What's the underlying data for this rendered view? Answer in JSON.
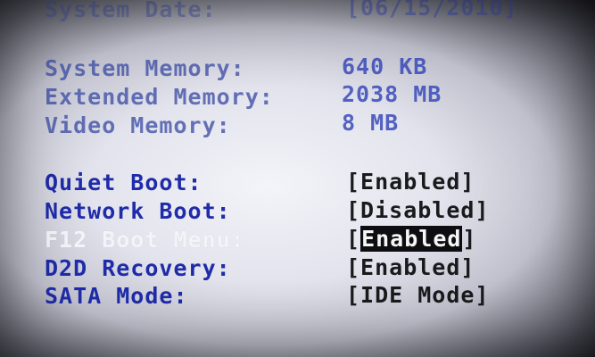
{
  "system_date": {
    "label": "System Date:",
    "value": "[06/15/2010]"
  },
  "info": {
    "system_memory": {
      "label": "System Memory:",
      "value": "640 KB"
    },
    "extended_memory": {
      "label": "Extended Memory:",
      "value": "2038 MB"
    },
    "video_memory": {
      "label": "Video Memory:",
      "value": "8 MB"
    }
  },
  "options": {
    "quiet_boot": {
      "label": "Quiet Boot:",
      "value": "[Enabled]"
    },
    "network_boot": {
      "label": "Network Boot:",
      "value": "[Disabled]"
    },
    "f12_boot_menu": {
      "label": "F12 Boot Menu:",
      "value_open": "[",
      "value_selected": "Enabled",
      "value_close": "]"
    },
    "d2d_recovery": {
      "label": "D2D Recovery:",
      "value": "[Enabled]"
    },
    "sata_mode": {
      "label": "SATA Mode:",
      "value": "[IDE Mode]"
    }
  }
}
